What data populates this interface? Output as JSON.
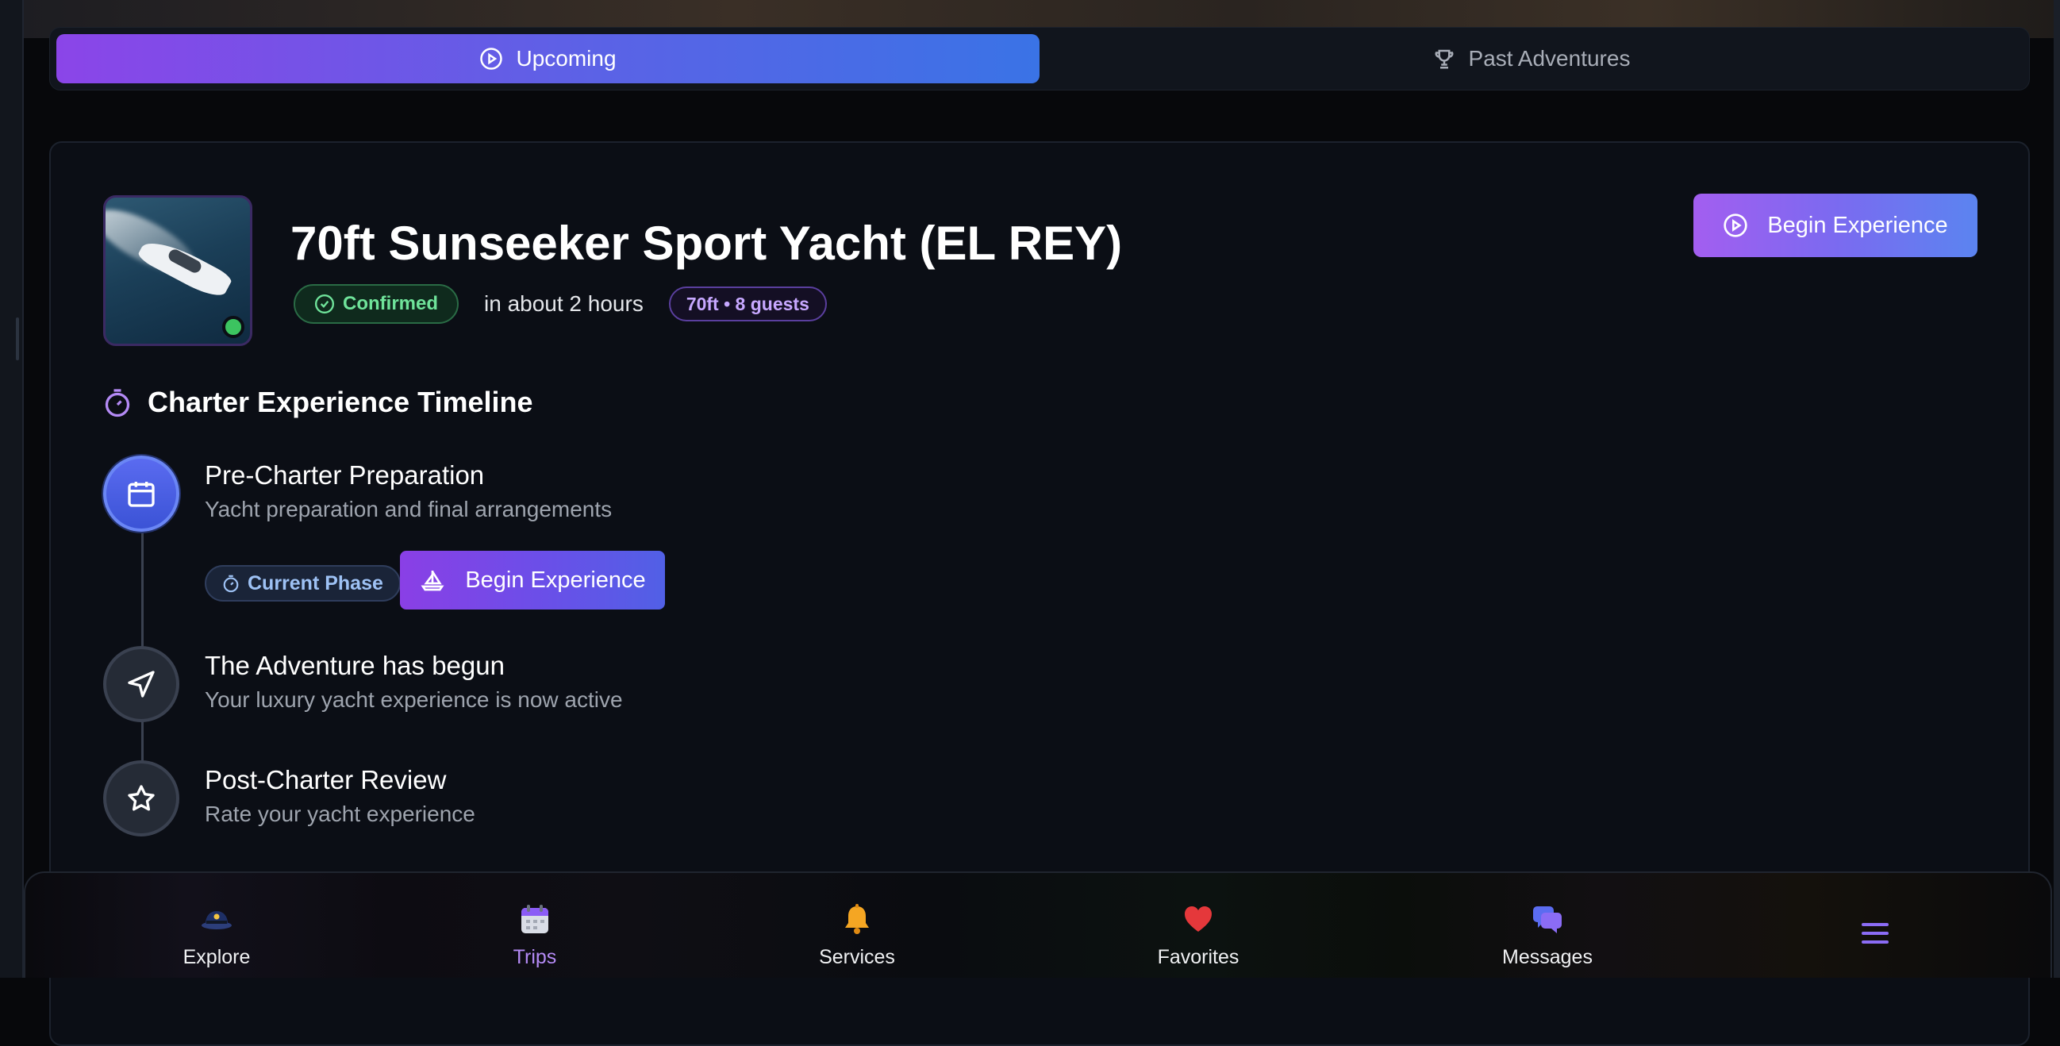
{
  "tabs": {
    "upcoming": "Upcoming",
    "past": "Past Adventures"
  },
  "booking": {
    "title": "70ft Sunseeker Sport Yacht (EL REY)",
    "status": "Confirmed",
    "when": "in about 2 hours",
    "spec": "70ft • 8 guests",
    "begin_label": "Begin Experience"
  },
  "timeline": {
    "heading": "Charter Experience Timeline",
    "steps": [
      {
        "title": "Pre-Charter Preparation",
        "description": "Yacht preparation and final arrangements",
        "phase_badge": "Current Phase",
        "action_label": "Begin Experience",
        "icon": "calendar-icon"
      },
      {
        "title": "The Adventure has begun",
        "description": "Your luxury yacht experience is now active",
        "icon": "navigation-arrow-icon"
      },
      {
        "title": "Post-Charter Review",
        "description": "Rate your yacht experience",
        "icon": "star-icon"
      }
    ]
  },
  "bottom_nav": [
    {
      "label": "Explore",
      "icon": "captain-hat-icon"
    },
    {
      "label": "Trips",
      "icon": "calendar-icon",
      "active": true
    },
    {
      "label": "Services",
      "icon": "bell-icon"
    },
    {
      "label": "Favorites",
      "icon": "heart-icon"
    },
    {
      "label": "Messages",
      "icon": "chat-bubbles-icon"
    },
    {
      "label": "",
      "icon": "menu-icon"
    }
  ],
  "colors": {
    "accent_purple": "#8b45e8",
    "accent_blue": "#3a73e6",
    "confirmed_green": "#6fe39a",
    "online_green": "#3cc460"
  }
}
